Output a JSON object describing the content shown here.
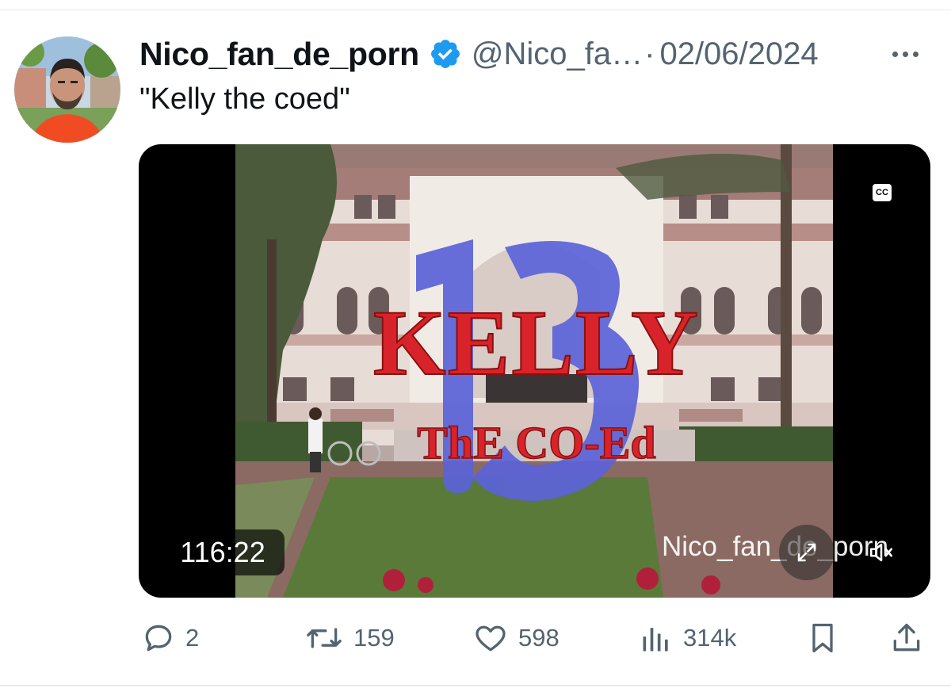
{
  "tweet": {
    "author": {
      "display_name": "Nico_fan_de_porn",
      "handle": "@Nico_fa…",
      "verified": true
    },
    "separator": "·",
    "date": "02/06/2024",
    "text": "\"Kelly the coed\"",
    "media": {
      "title_line1": "KELLY",
      "title_line2": "ThE CO-Ed",
      "cc_label": "CC",
      "timestamp": "116:22",
      "watermark": "Nico_fan_de_porn"
    },
    "actions": {
      "replies": "2",
      "reposts": "159",
      "likes": "598",
      "views": "314k"
    }
  },
  "icons": [
    "verified-badge-icon",
    "more-icon",
    "cc-icon",
    "expand-icon",
    "mute-icon",
    "reply-icon",
    "repost-icon",
    "like-icon",
    "views-icon",
    "bookmark-icon",
    "share-icon"
  ],
  "colors": {
    "text_primary": "#0f1419",
    "text_secondary": "#536471",
    "verified_blue": "#1d9bf0",
    "title_red": "#d8232a",
    "title_blue": "#5b63d8"
  }
}
